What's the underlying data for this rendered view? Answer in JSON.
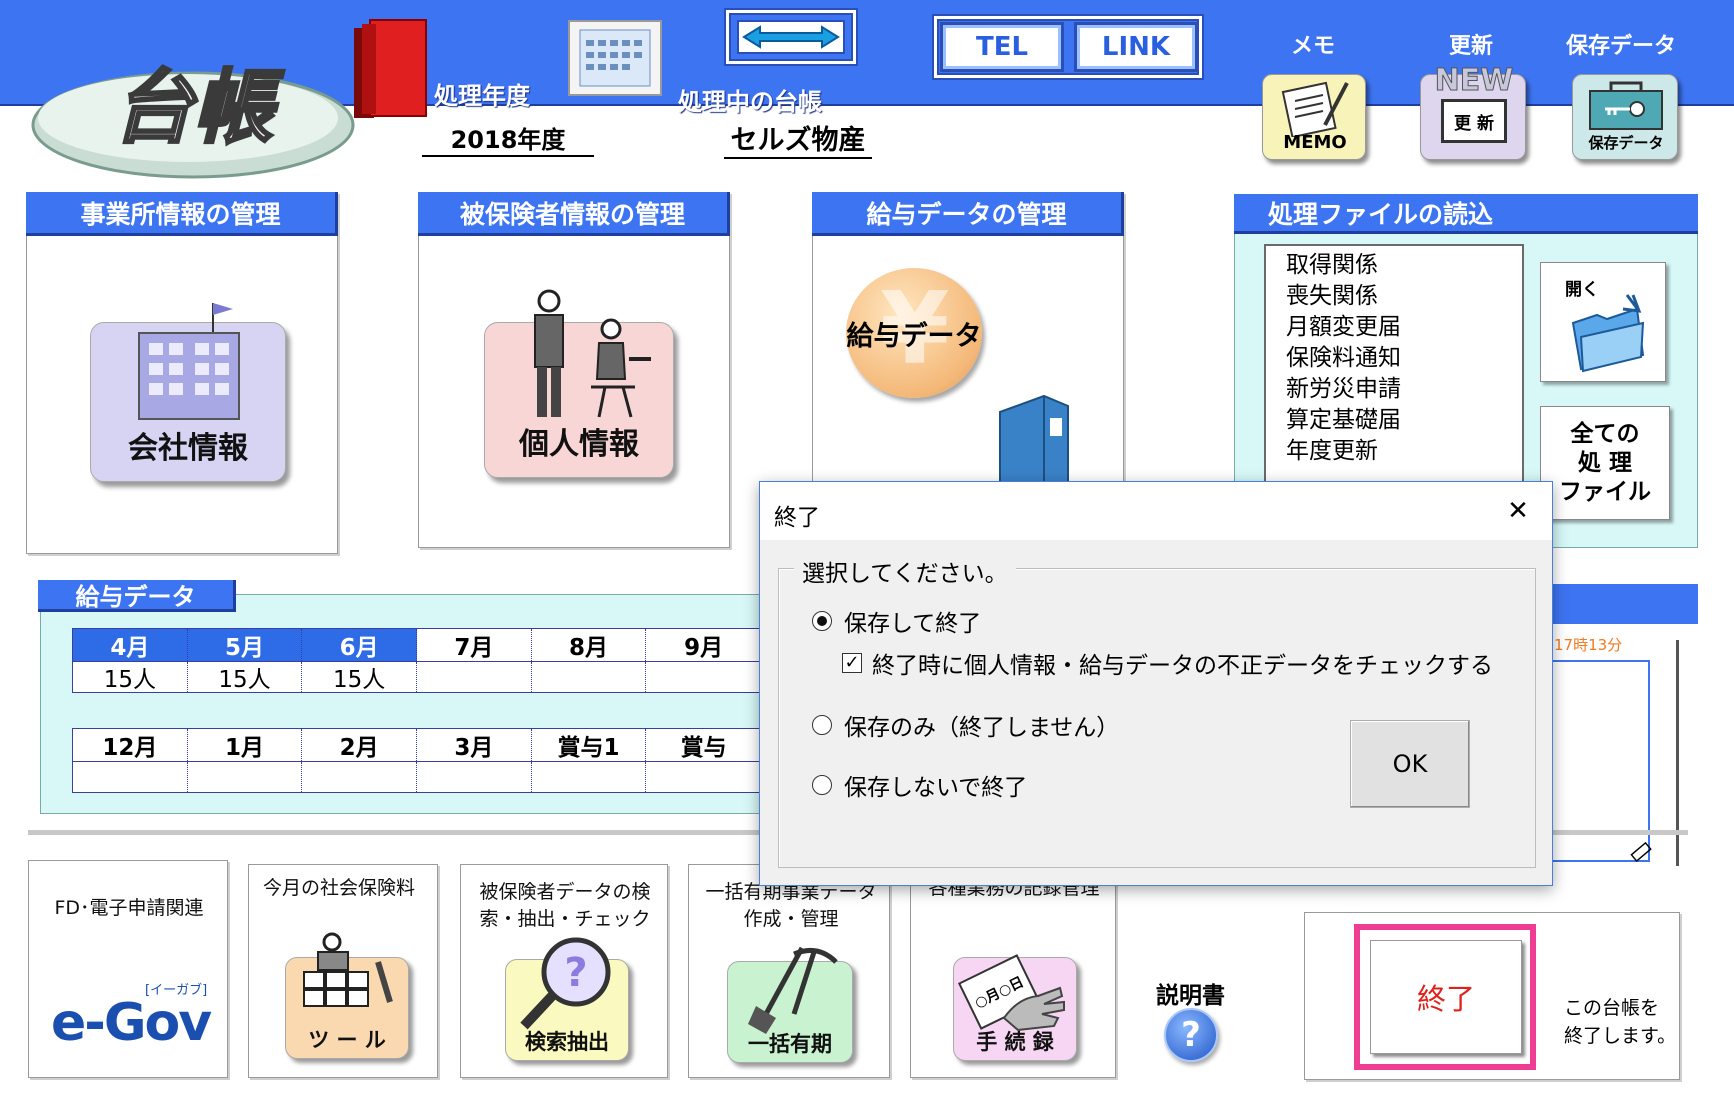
{
  "header": {
    "logo_text": "台帳",
    "year_label": "処理年度",
    "year_value": "2018年度",
    "ledger_label": "処理中の台帳",
    "ledger_value": "セルズ物産",
    "tel_label": "TEL",
    "link_label": "LINK",
    "memo_caption": "メモ",
    "memo_button": "MEMO",
    "update_caption": "更新",
    "update_new": "NEW",
    "update_button": "更 新",
    "saved_caption": "保存データ",
    "saved_button": "保存データ"
  },
  "sections": {
    "office": {
      "title": "事業所情報の管理",
      "button": "会社情報"
    },
    "insured": {
      "title": "被保険者情報の管理",
      "button": "個人情報"
    },
    "salary": {
      "title": "給与データの管理",
      "button": "給与データ"
    },
    "files": {
      "title": "処理ファイルの読込",
      "items": [
        "取得関係",
        "喪失関係",
        "月額変更届",
        "保険料通知",
        "新労災申請",
        "算定基礎届",
        "年度更新"
      ],
      "open_label": "開く",
      "all_files": [
        "全ての",
        "処 理",
        "ファイル"
      ]
    }
  },
  "salary_grid": {
    "title": "給与データ",
    "row1_headers": [
      "4月",
      "5月",
      "6月",
      "7月",
      "8月",
      "9月"
    ],
    "row1_values": [
      "15人",
      "15人",
      "15人",
      "",
      "",
      ""
    ],
    "row2_headers": [
      "12月",
      "1月",
      "2月",
      "3月",
      "賞与1",
      "賞与"
    ],
    "row2_values": [
      "",
      "",
      "",
      "",
      "",
      ""
    ]
  },
  "right_panel": {
    "time": "17時13分"
  },
  "tools": {
    "fd": {
      "title": "FD･電子申請関連",
      "logo_small": "[イーガブ]",
      "logo_main": "e-Gov"
    },
    "premium": {
      "title": "今月の社会保険料",
      "button": "ツ ー ル"
    },
    "search": {
      "title": "被保険者データの検索・抽出・チェック",
      "button": "検索抽出"
    },
    "bulk": {
      "title": "一括有期事業データ作成・管理",
      "button": "一括有期"
    },
    "records": {
      "title": "各種業務の記録管理",
      "button": "手 続 録",
      "card": "○月○日"
    },
    "manual": {
      "label": "説明書"
    },
    "exit": {
      "button": "終了",
      "desc_line1": "この台帳を",
      "desc_line2": "終了します。"
    }
  },
  "dialog": {
    "title": "終了",
    "group_label": "選択してください。",
    "options": [
      "保存して終了",
      "保存のみ（終了しません）",
      "保存しないで終了"
    ],
    "selected": 0,
    "checkbox_label": "終了時に個人情報・給与データの不正データをチェックする",
    "checkbox_checked": true,
    "ok_label": "OK",
    "close_glyph": "✕"
  },
  "colors": {
    "header_blue": "#3d74f2",
    "exit_highlight": "#ee3d93",
    "exit_text": "#e0201c"
  }
}
